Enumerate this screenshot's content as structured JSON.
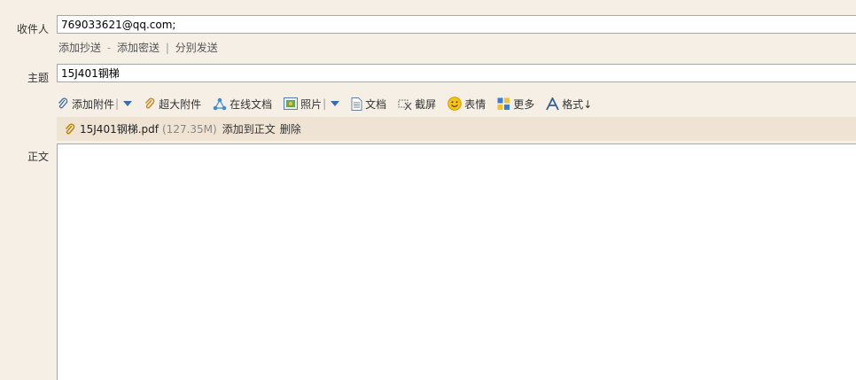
{
  "recipient": {
    "label": "收件人",
    "value": "769033621@qq.com;"
  },
  "recipient_links": {
    "add_cc": "添加抄送",
    "sep1": "-",
    "add_bcc": "添加密送",
    "sep2": "|",
    "separate_send": "分别发送"
  },
  "subject": {
    "label": "主题",
    "value": "15J401钢梯"
  },
  "toolbar": {
    "add_attachment": "添加附件",
    "bar1": "|",
    "large_attachment": "超大附件",
    "online_doc": "在线文档",
    "photo": "照片",
    "bar2": "|",
    "doc": "文档",
    "screenshot": "截屏",
    "emoji": "表情",
    "more": "更多",
    "format": "格式↓"
  },
  "attachment": {
    "filename": "15J401钢梯.pdf",
    "size": "(127.35M)",
    "add_to_body": "添加到正文",
    "delete": "删除"
  },
  "body": {
    "label": "正文"
  },
  "colors": {
    "background": "#f6efe6",
    "attachment_bar": "#efe3d4",
    "link_blue": "#3a6dad"
  }
}
